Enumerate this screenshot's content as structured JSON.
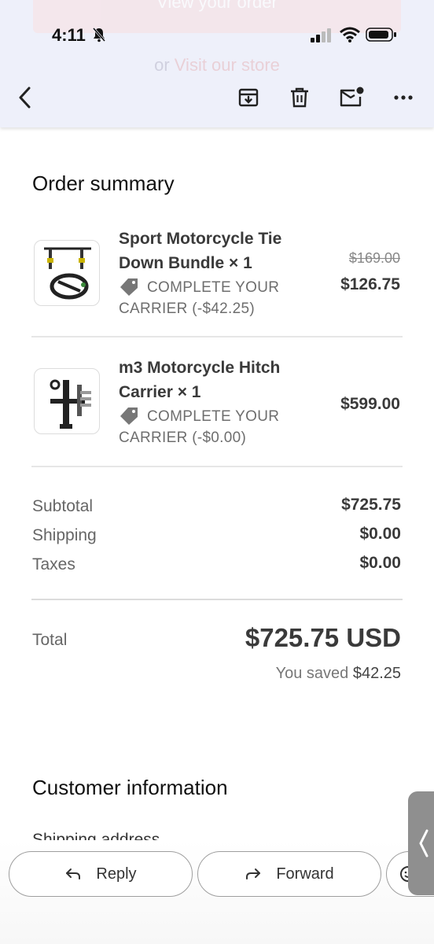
{
  "ghost": {
    "button": "View your order",
    "or": "or",
    "link": "Visit our store"
  },
  "status_bar": {
    "time": "4:11"
  },
  "icons": {
    "back": "back-arrow-icon",
    "archive": "archive-icon",
    "delete": "trash-icon",
    "mark_unread": "mail-unread-icon",
    "more": "more-icon"
  },
  "order_summary": {
    "title": "Order summary",
    "items": [
      {
        "title": "Sport Motorcycle Tie Down Bundle × 1",
        "discount": "COMPLETE YOUR CARRIER (-$42.25)",
        "original_price": "$169.00",
        "price": "$126.75"
      },
      {
        "title": "m3 Motorcycle Hitch Carrier × 1",
        "discount": "COMPLETE YOUR CARRIER (-$0.00)",
        "price": "$599.00"
      }
    ],
    "subtotal_label": "Subtotal",
    "subtotal": "$725.75",
    "shipping_label": "Shipping",
    "shipping": "$0.00",
    "taxes_label": "Taxes",
    "taxes": "$0.00",
    "total_label": "Total",
    "total": "$725.75 USD",
    "saved_label": "You saved",
    "saved": "$42.25"
  },
  "customer_info": {
    "title": "Customer information",
    "shipping_address": "Shipping address"
  },
  "actions": {
    "reply": "Reply",
    "forward": "Forward"
  },
  "colors": {
    "header_bg": "#eef0fa",
    "text_dark": "#3a3a3a",
    "text_muted": "#666666"
  }
}
